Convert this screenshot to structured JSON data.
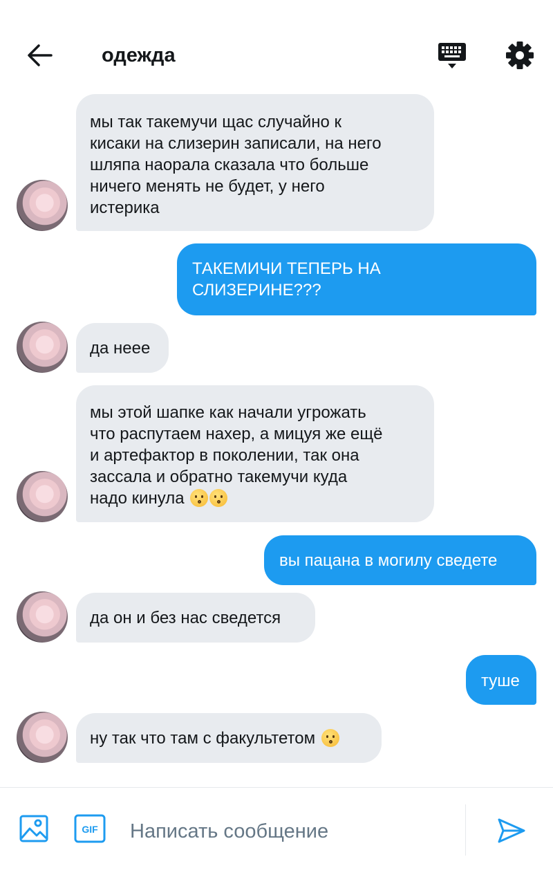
{
  "header": {
    "title": "одежда",
    "icons": {
      "back": "arrow-left-icon",
      "keyboard": "keyboard-icon",
      "settings": "gear-icon"
    }
  },
  "messages": [
    {
      "direction": "incoming",
      "text": "мы так такемучи щас случайно к\nкисаки на слизерин записали, на него\nшляпа наорала сказала что больше\nничего менять не будет, у него\nистерика"
    },
    {
      "direction": "outgoing",
      "text": "ТАКЕМИЧИ ТЕПЕРЬ НА\nСЛИЗЕРИНЕ???"
    },
    {
      "direction": "incoming",
      "text": "да неее"
    },
    {
      "direction": "incoming",
      "text": "мы этой шапке как начали угрожать\nчто распутаем нахер, а мицуя же ещё\nи артефактор в поколении, так она\nзассала и обратно такемучи куда\nнадо кинула",
      "emoji": [
        "kissing-face",
        "kissing-face"
      ]
    },
    {
      "direction": "outgoing",
      "text": "вы пацана в могилу сведете"
    },
    {
      "direction": "incoming",
      "text": "да он и без нас сведется"
    },
    {
      "direction": "outgoing",
      "text": "туше"
    },
    {
      "direction": "incoming",
      "text": "ну так что там с факультетом",
      "emoji": [
        "kissing-face"
      ]
    }
  ],
  "composer": {
    "placeholder": "Написать сообщение",
    "gif_label": "GIF",
    "icons": {
      "image": "image-icon",
      "gif": "gif-icon",
      "send": "send-icon"
    }
  },
  "colors": {
    "accent": "#1d9bf0",
    "incoming_bubble": "#e8ebef",
    "text": "#14171a",
    "placeholder": "#657786"
  }
}
